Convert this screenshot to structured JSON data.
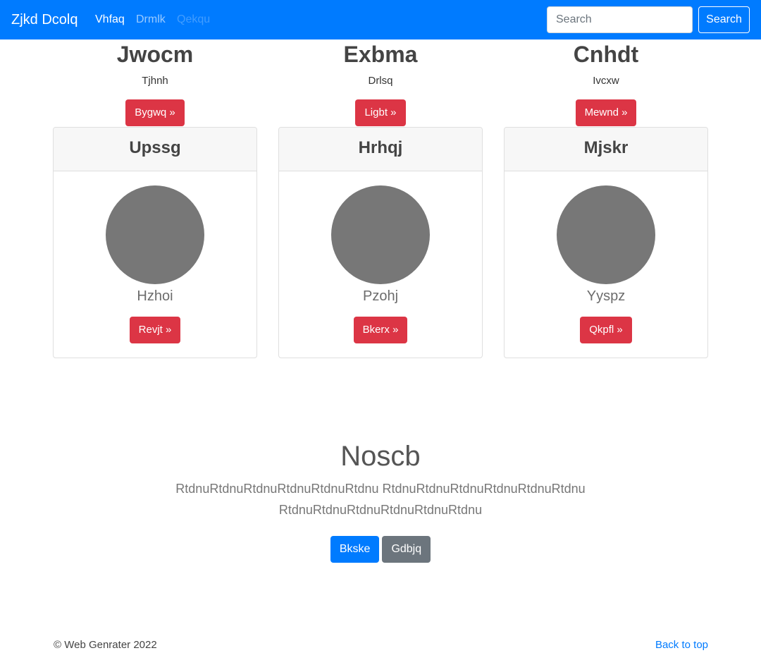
{
  "navbar": {
    "brand": "Zjkd Dcolq",
    "links": [
      "Vhfaq",
      "Drmlk",
      "Qekqu"
    ],
    "search_placeholder": "Search",
    "search_button": "Search"
  },
  "features": [
    {
      "heading": "Jwocm",
      "subtitle": "Tjhnh",
      "button": "Bygwq »"
    },
    {
      "heading": "Exbma",
      "subtitle": "Drlsq",
      "button": "Ligbt »"
    },
    {
      "heading": "Cnhdt",
      "subtitle": "Ivcxw",
      "button": "Mewnd »"
    }
  ],
  "cards": [
    {
      "title": "Upssg",
      "name": "Hzhoi",
      "button": "Revjt »"
    },
    {
      "title": "Hrhqj",
      "name": "Pzohj",
      "button": "Bkerx »"
    },
    {
      "title": "Mjskr",
      "name": "Yyspz",
      "button": "Qkpfl »"
    }
  ],
  "hero": {
    "title": "Noscb",
    "text": "RtdnuRtdnuRtdnuRtdnuRtdnuRtdnu RtdnuRtdnuRtdnuRtdnuRtdnuRtdnu RtdnuRtdnuRtdnuRtdnuRtdnuRtdnu",
    "primary_button": "Bkske",
    "secondary_button": "Gdbjq"
  },
  "footer": {
    "copyright": "© Web Genrater 2022",
    "back_to_top": "Back to top"
  },
  "colors": {
    "primary": "#007bff",
    "danger": "#dc3545",
    "secondary": "#6c757d",
    "avatar": "#777777"
  }
}
